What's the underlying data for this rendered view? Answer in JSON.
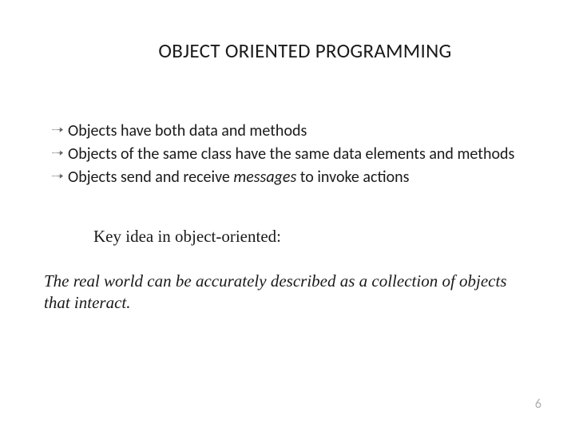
{
  "title": "OBJECT ORIENTED PROGRAMMING",
  "bullets": {
    "item1": "Objects have both data and methods",
    "item2_part1": " Objects of the same class have the same data elements and methods",
    "item3_part1": " Objects send and receive ",
    "item3_italic": "messages",
    "item3_part2": " to invoke actions"
  },
  "key_idea": "Key idea in object-oriented:",
  "description": "The real world can be accurately described as a collection of objects that interact.",
  "page_number": "6"
}
